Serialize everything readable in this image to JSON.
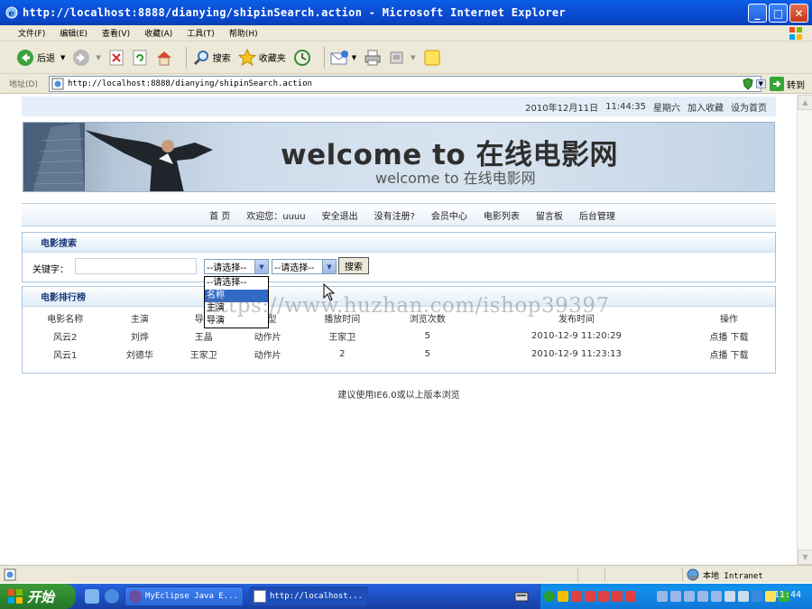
{
  "window": {
    "title": "http://localhost:8888/dianying/shipinSearch.action - Microsoft Internet Explorer"
  },
  "menu": [
    "文件(F)",
    "编辑(E)",
    "查看(V)",
    "收藏(A)",
    "工具(T)",
    "帮助(H)"
  ],
  "toolbar": {
    "back_label": "后退",
    "search_label": "搜索",
    "favorites_label": "收藏夹"
  },
  "address": {
    "label": "地址(D)",
    "url": "http://localhost:8888/dianying/shipinSearch.action",
    "go_label": "转到"
  },
  "page": {
    "datebar": {
      "date": "2010年12月11日",
      "time": "11:44:35",
      "weekday": "星期六",
      "add_favorite": "加入收藏",
      "set_home": "设为首页"
    },
    "banner": {
      "title": "welcome to 在线电影网",
      "subtitle": "welcome to 在线电影网"
    },
    "nav": {
      "home": "首 页",
      "welcome": "欢迎您：uuuu",
      "logout": "安全退出",
      "register": "没有注册?",
      "member": "会员中心",
      "movies": "电影列表",
      "guestbook": "留言板",
      "admin": "后台管理"
    },
    "search": {
      "header": "电影搜索",
      "keyword_label": "关键字：",
      "keyword_value": "",
      "select1_value": "--请选择--",
      "select2_value": "--请选择--",
      "button": "搜索",
      "select1_options": [
        "--请选择--",
        "名称",
        "主演",
        "导演"
      ],
      "select1_highlighted": "名称"
    },
    "ranking": {
      "header": "电影排行榜",
      "columns": [
        "电影名称",
        "主演",
        "导演",
        "类型",
        "播放时间",
        "浏览次数",
        "发布时间",
        "操作"
      ],
      "rows": [
        {
          "name": "风云2",
          "star": "刘烨",
          "director": "王晶",
          "type": "动作片",
          "playtime": "王家卫",
          "views": "5",
          "published": "2010-12-9 11:20:29",
          "play": "点播",
          "download": "下载"
        },
        {
          "name": "风云1",
          "star": "刘德华",
          "director": "王家卫",
          "type": "动作片",
          "playtime": "2",
          "views": "5",
          "published": "2010-12-9 11:23:13",
          "play": "点播",
          "download": "下载"
        }
      ]
    },
    "footer_note": "建议使用IE6.0或以上版本浏览"
  },
  "watermark": "https://www.huzhan.com/ishop39397",
  "status": {
    "zone": "本地 Intranet"
  },
  "taskbar": {
    "start": "开始",
    "tasks": [
      "MyEclipse Java E...",
      "http://localhost..."
    ],
    "clock": "11:44"
  },
  "colors": {
    "titlebar": "#0a4fd6",
    "chrome": "#ece9d8",
    "panel_border": "#a6c3dd",
    "selected_option": "#316ac5",
    "taskbar": "#245edb",
    "start": "#2f8a2f"
  }
}
